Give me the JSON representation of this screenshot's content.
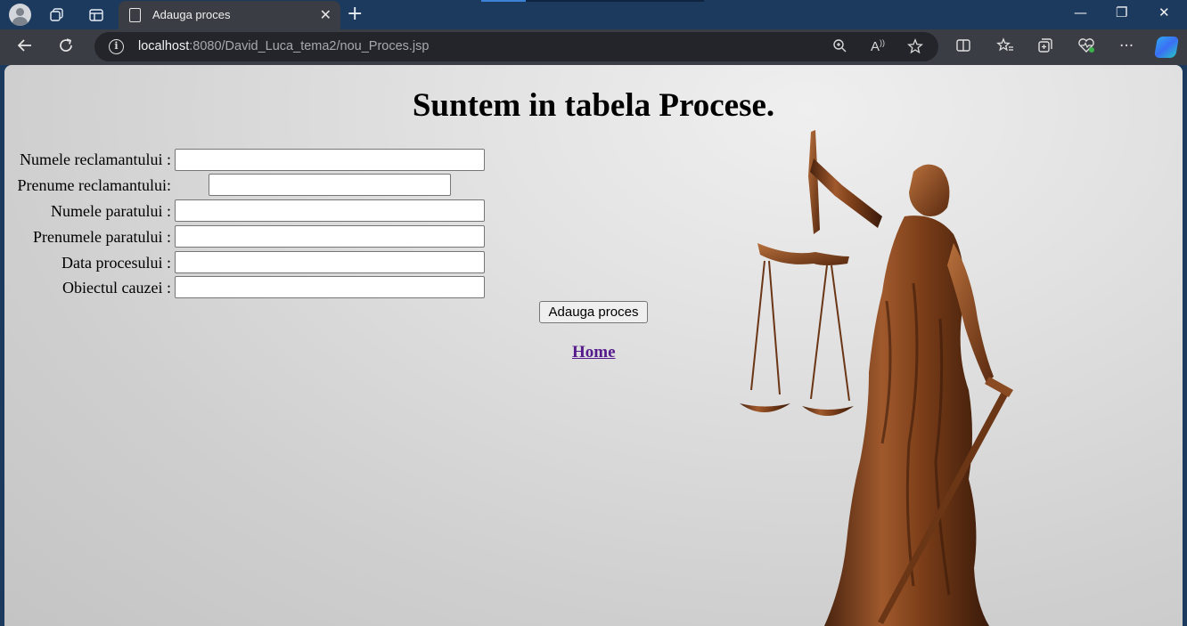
{
  "browser": {
    "tab_title": "Adauga proces",
    "tab_close": "✕",
    "new_tab": "+",
    "url_host": "localhost",
    "url_path": ":8080/David_Luca_tema2/nou_Proces.jsp",
    "minimize": "—",
    "restore": "❐",
    "close": "✕",
    "more": "···",
    "info": "i"
  },
  "page": {
    "title": "Suntem in tabela Procese.",
    "form": {
      "fields": [
        {
          "label": "Numele reclamantului :",
          "value": ""
        },
        {
          "label": "Prenume reclamantului:",
          "value": ""
        },
        {
          "label": "Numele paratului :",
          "value": ""
        },
        {
          "label": "Prenumele paratului :",
          "value": ""
        },
        {
          "label": "Data procesului :",
          "value": ""
        },
        {
          "label": "Obiectul cauzei :",
          "value": ""
        }
      ],
      "submit_label": "Adauga proces"
    },
    "home_link": "Home",
    "image": "lady-justice-statue"
  },
  "colors": {
    "titlebar": "#1c3a5e",
    "toolbar": "#3a3d43",
    "link_visited": "#551a8b",
    "statue_bronze": "#8a4a22"
  }
}
